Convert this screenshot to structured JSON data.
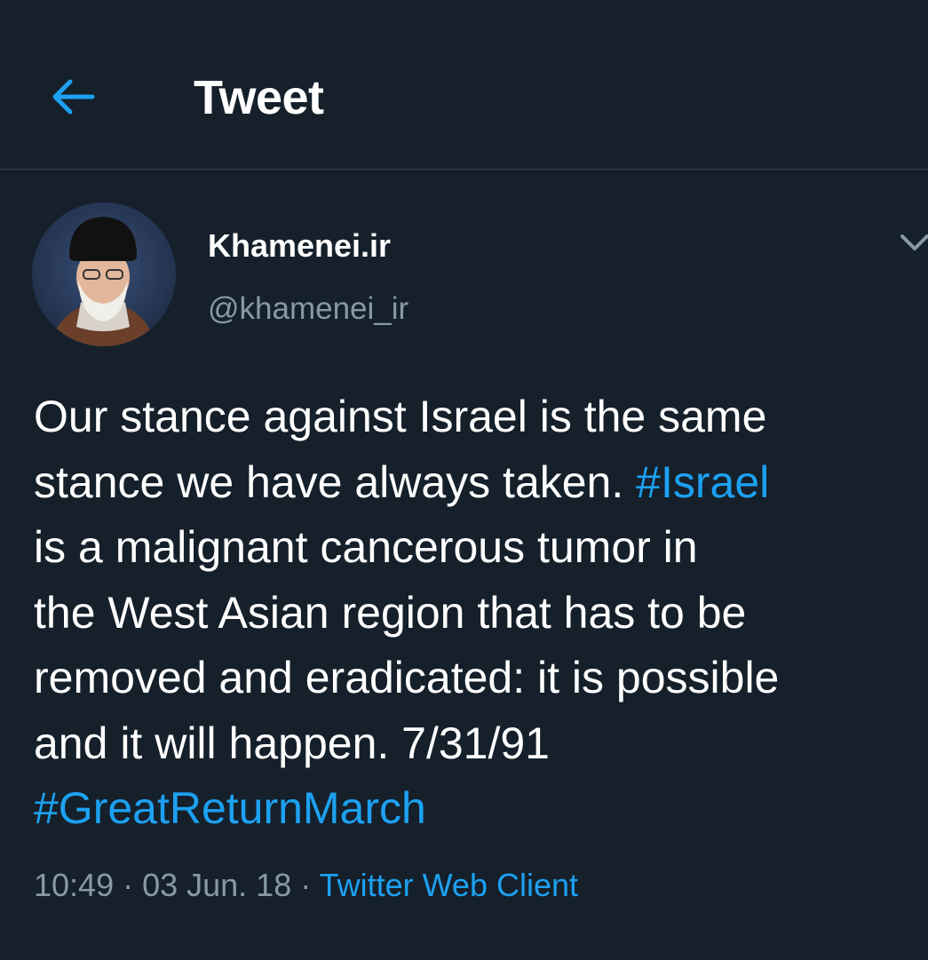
{
  "colors": {
    "background": "#15202b",
    "accent": "#1da1f2",
    "text_primary": "#ffffff",
    "text_secondary": "#8899a6",
    "divider": "#38444d"
  },
  "header": {
    "back_icon": "arrow-left-icon",
    "title": "Tweet"
  },
  "author": {
    "display_name": "Khamenei.ir",
    "handle": "@khamenei_ir",
    "menu_icon": "chevron-down-icon"
  },
  "tweet": {
    "line1": "Our stance against Israel is the same",
    "line2_text": "stance we have always taken. ",
    "line2_hashtag": "#Israel",
    "line3": "is a malignant cancerous tumor in",
    "line4": "the West Asian region that has to be",
    "line5": "removed and eradicated: it is possible",
    "line6": "and it will happen. 7/31/91",
    "line7_hashtag": "#GreatReturnMarch"
  },
  "meta": {
    "time": "10:49",
    "sep1": " · ",
    "date": "03 Jun. 18",
    "sep2": " · ",
    "source": "Twitter Web Client"
  }
}
